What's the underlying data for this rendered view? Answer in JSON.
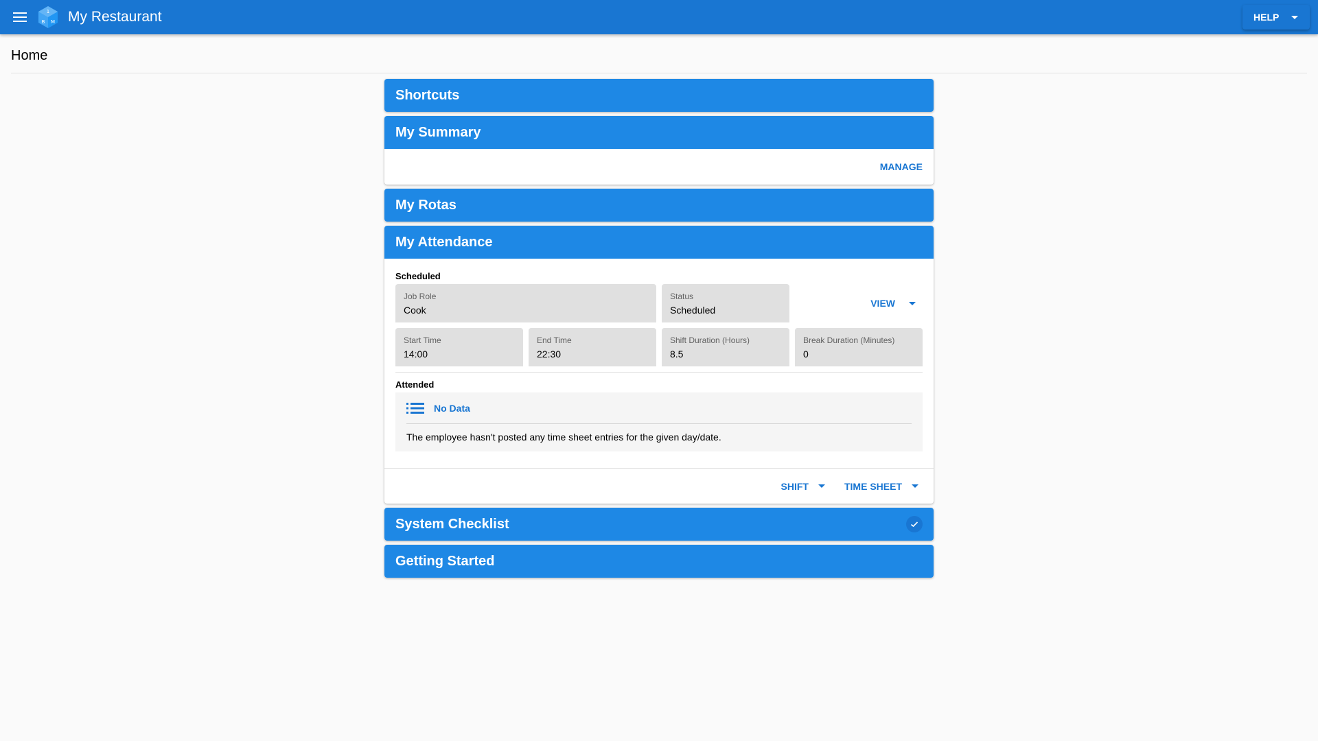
{
  "app": {
    "title": "My Restaurant",
    "help_label": "HELP",
    "colors": {
      "appbar": "#1976d2",
      "panel_header": "#1e88e5",
      "accent": "#1976d2"
    }
  },
  "page": {
    "title": "Home"
  },
  "panels": {
    "shortcuts": {
      "title": "Shortcuts"
    },
    "summary": {
      "title": "My Summary",
      "manage_label": "MANAGE"
    },
    "rotas": {
      "title": "My Rotas"
    },
    "attendance": {
      "title": "My Attendance",
      "scheduled_label": "Scheduled",
      "fields": {
        "job_role": {
          "label": "Job Role",
          "value": "Cook"
        },
        "status": {
          "label": "Status",
          "value": "Scheduled"
        },
        "start_time": {
          "label": "Start Time",
          "value": "14:00"
        },
        "end_time": {
          "label": "End Time",
          "value": "22:30"
        },
        "shift_duration": {
          "label": "Shift Duration (Hours)",
          "value": "8.5"
        },
        "break_duration": {
          "label": "Break Duration (Minutes)",
          "value": "0"
        }
      },
      "view_label": "VIEW",
      "attended_label": "Attended",
      "no_data_title": "No Data",
      "no_data_message": "The employee hasn't posted any time sheet entries for the given day/date.",
      "shift_label": "SHIFT",
      "time_sheet_label": "TIME SHEET"
    },
    "checklist": {
      "title": "System Checklist",
      "status_icon": "check-icon"
    },
    "getting_started": {
      "title": "Getting Started"
    }
  }
}
